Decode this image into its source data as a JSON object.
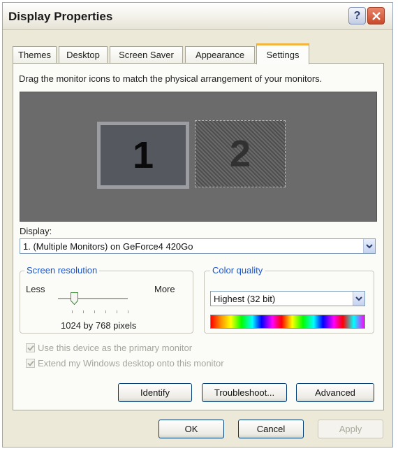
{
  "window": {
    "title": "Display Properties"
  },
  "tabs": [
    {
      "label": "Themes"
    },
    {
      "label": "Desktop"
    },
    {
      "label": "Screen Saver"
    },
    {
      "label": "Appearance"
    },
    {
      "label": "Settings",
      "active": true
    }
  ],
  "instruction": "Drag the monitor icons to match the physical arrangement of your monitors.",
  "monitors": [
    {
      "number": "1",
      "selected": true
    },
    {
      "number": "2",
      "selected": false
    }
  ],
  "display": {
    "label": "Display:",
    "value": "1. (Multiple Monitors) on GeForce4 420Go"
  },
  "resolution": {
    "legend": "Screen resolution",
    "less": "Less",
    "more": "More",
    "value": "1024 by 768 pixels"
  },
  "color_quality": {
    "legend": "Color quality",
    "value": "Highest (32 bit)"
  },
  "checkboxes": [
    {
      "label": "Use this device as the primary monitor",
      "checked": true,
      "disabled": true
    },
    {
      "label": "Extend my Windows desktop onto this monitor",
      "checked": true,
      "disabled": true
    }
  ],
  "buttons": {
    "identify": "Identify",
    "troubleshoot": "Troubleshoot...",
    "advanced": "Advanced",
    "ok": "OK",
    "cancel": "Cancel",
    "apply": "Apply"
  },
  "colors": {
    "active_tab_accent": "#f2b540",
    "group_legend": "#1e56c8",
    "close_button": "#c94a2a",
    "monitor_area": "#6b6b6b"
  }
}
